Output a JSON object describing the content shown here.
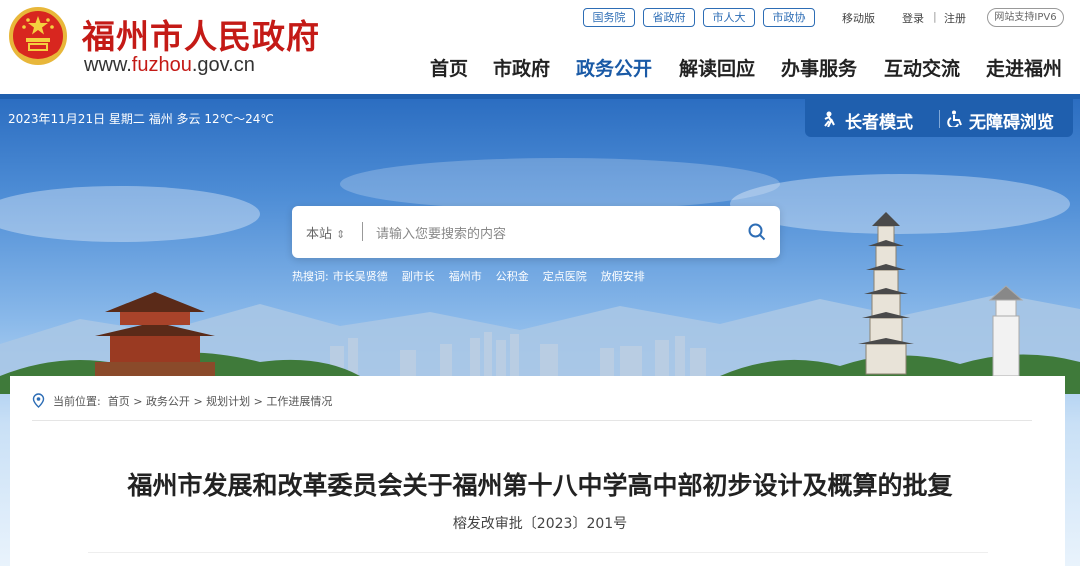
{
  "header": {
    "site_title": "福州市人民政府",
    "url_prefix": "www.",
    "url_domain": "fuzhou",
    "url_suffix": ".gov.cn",
    "toplinks": [
      "国务院",
      "省政府",
      "市人大",
      "市政协"
    ],
    "mobile": "移动版",
    "login": "登录",
    "separator": "|",
    "register": "注册",
    "ipv6": "网站支持IPV6"
  },
  "nav": {
    "items": [
      "首页",
      "市政府",
      "政务公开",
      "解读回应",
      "办事服务",
      "互动交流",
      "走进福州"
    ],
    "active": "政务公开"
  },
  "banner": {
    "date_weather": "2023年11月21日 星期二  福州 多云 12℃～24℃",
    "elder_mode": "长者模式",
    "accessible": "无障碍浏览"
  },
  "search": {
    "scope": "本站",
    "scope_arrow": "⇕",
    "placeholder": "请输入您要搜索的内容",
    "hot_label": "热搜词:",
    "hot_terms": [
      "市长吴贤德",
      "副市长",
      "福州市",
      "公积金",
      "定点医院",
      "放假安排"
    ]
  },
  "breadcrumb": {
    "label": "当前位置:",
    "items": [
      "首页",
      "政务公开",
      "规划计划",
      "工作进展情况"
    ],
    "sep": ">"
  },
  "document": {
    "title": "福州市发展和改革委员会关于福州第十八中学高中部初步设计及概算的批复",
    "number": "榕发改审批〔2023〕201号"
  },
  "colors": {
    "brand_red": "#c41a16",
    "brand_blue": "#1f5fae",
    "nav_active": "#1a5aa6"
  }
}
